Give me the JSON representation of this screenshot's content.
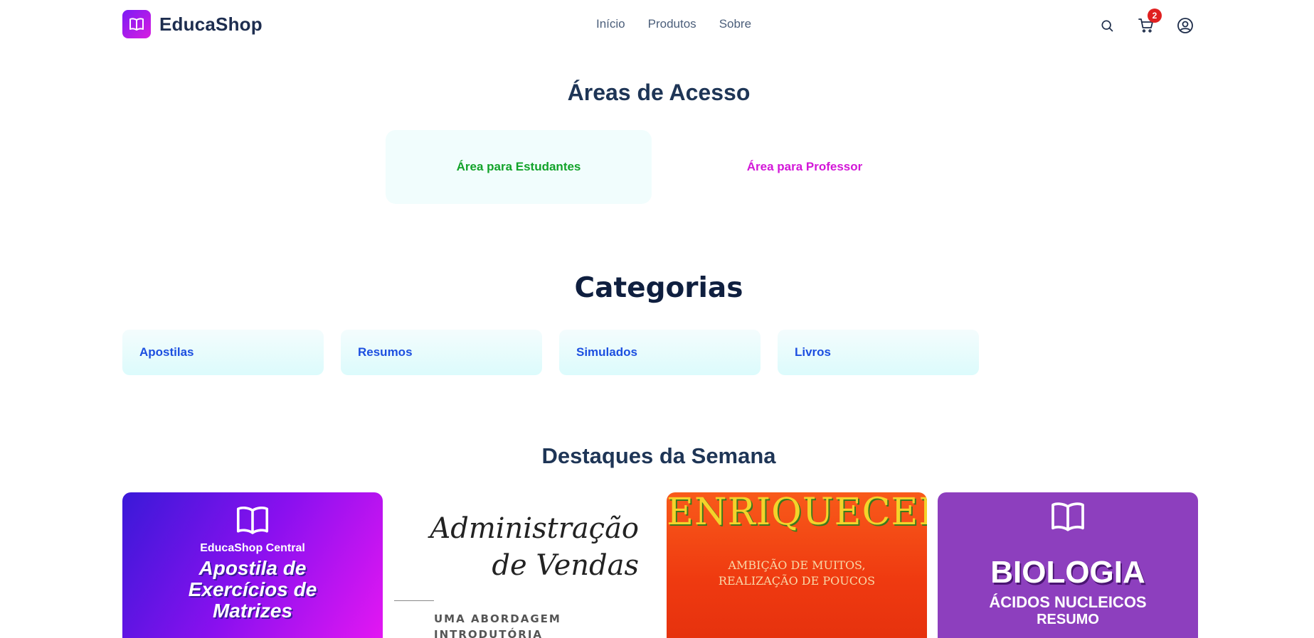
{
  "header": {
    "brand": "EducaShop",
    "nav": [
      "Início",
      "Produtos",
      "Sobre"
    ],
    "cart_count": "2",
    "icons": [
      "search-icon",
      "cart-icon",
      "user-icon"
    ]
  },
  "access": {
    "title": "Áreas de Acesso",
    "student": "Área para Estudantes",
    "teacher": "Área para Professor"
  },
  "categories": {
    "title": "Categorias",
    "items": [
      "Apostilas",
      "Resumos",
      "Simulados",
      "Livros"
    ]
  },
  "highlights": {
    "title": "Destaques da Semana",
    "products": [
      {
        "brand": "EducaShop Central",
        "title_line1": "Apostila de",
        "title_line2": "Exercícios de",
        "title_line3": "Matrizes"
      },
      {
        "title_line1": "Administração",
        "title_line2": "de Vendas",
        "sub_line1": "UMA ABORDAGEM",
        "sub_line2": "INTRODUTÓRIA"
      },
      {
        "title": "ENRIQUECER",
        "sub_line1": "AMBIÇÃO DE MUITOS,",
        "sub_line2": "REALIZAÇÃO DE POUCOS"
      },
      {
        "title": "BIOLOGIA",
        "sub": "ÁCIDOS NUCLEICOS",
        "sub2": "RESUMO"
      }
    ]
  },
  "colors": {
    "brand_gradient_start": "#7b1cf5",
    "brand_gradient_end": "#d81de0",
    "student": "#12a32a",
    "teacher": "#d317d8",
    "category_text": "#1c4fe0"
  }
}
